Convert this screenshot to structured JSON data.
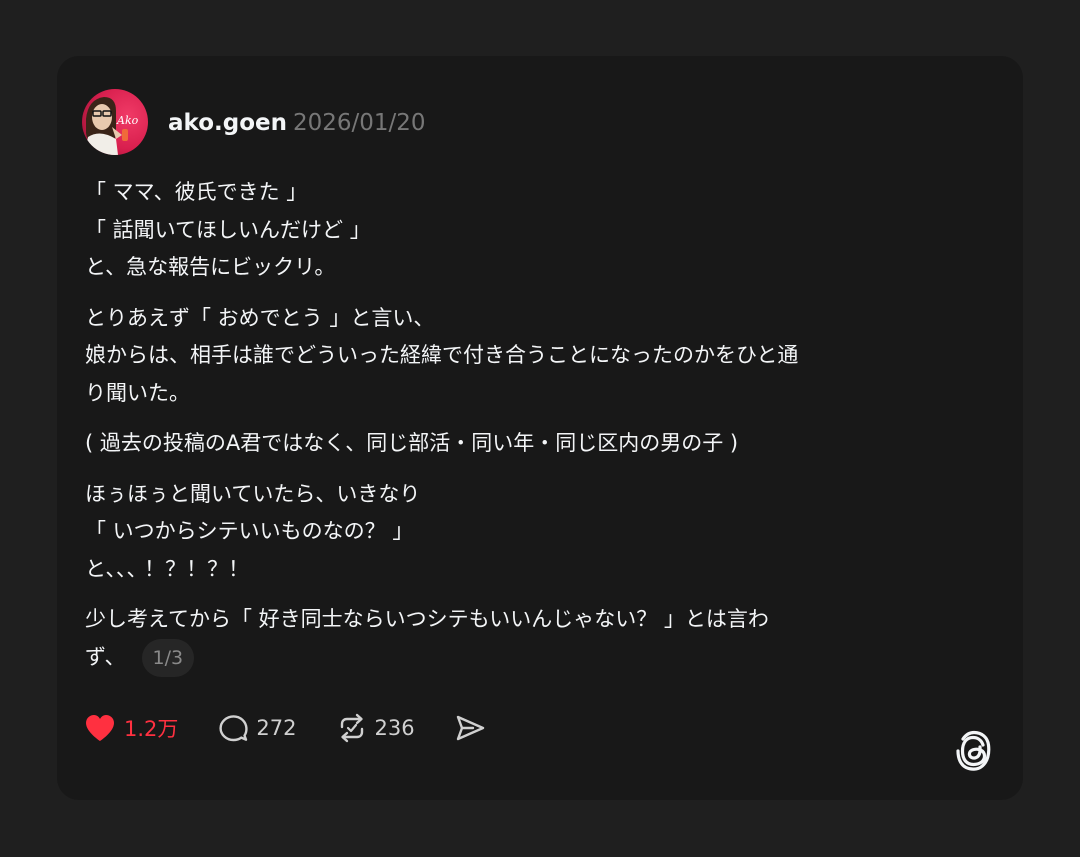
{
  "post": {
    "username": "ako.goen",
    "date": "2026/01/20",
    "avatar_text": "Ako",
    "paragraphs": [
      {
        "lines": [
          "「 ママ、彼氏できた 」",
          "「 話聞いてほしいんだけど 」",
          "と、急な報告にビックリ。"
        ]
      },
      {
        "lines": [
          "とりあえず「 おめでとう 」と言い、",
          "娘からは、相手は誰でどういった経緯で付き合うことになったのかをひと通",
          "り聞いた。"
        ]
      },
      {
        "lines": [
          "( 過去の投稿のA君ではなく、同じ部活・同い年・同じ区内の男の子 )"
        ]
      },
      {
        "lines": [
          "ほぅほぅと聞いていたら、いきなり",
          "「 いつからシテいいものなの？ 」",
          "と､､､ ！？！？！"
        ]
      },
      {
        "lines": [
          "少し考えてから「 好き同士ならいつシテもいいんじゃない？ 」とは言わ",
          "ず、"
        ]
      }
    ],
    "page_indicator": "1/3"
  },
  "actions": {
    "likes": "1.2万",
    "comments": "272",
    "reposts": "236"
  },
  "colors": {
    "like": "#ff3040",
    "background": "#1f1f1f",
    "card": "#181818"
  },
  "icons": [
    "heart-icon",
    "comment-icon",
    "repost-icon",
    "share-icon",
    "threads-logo-icon"
  ]
}
